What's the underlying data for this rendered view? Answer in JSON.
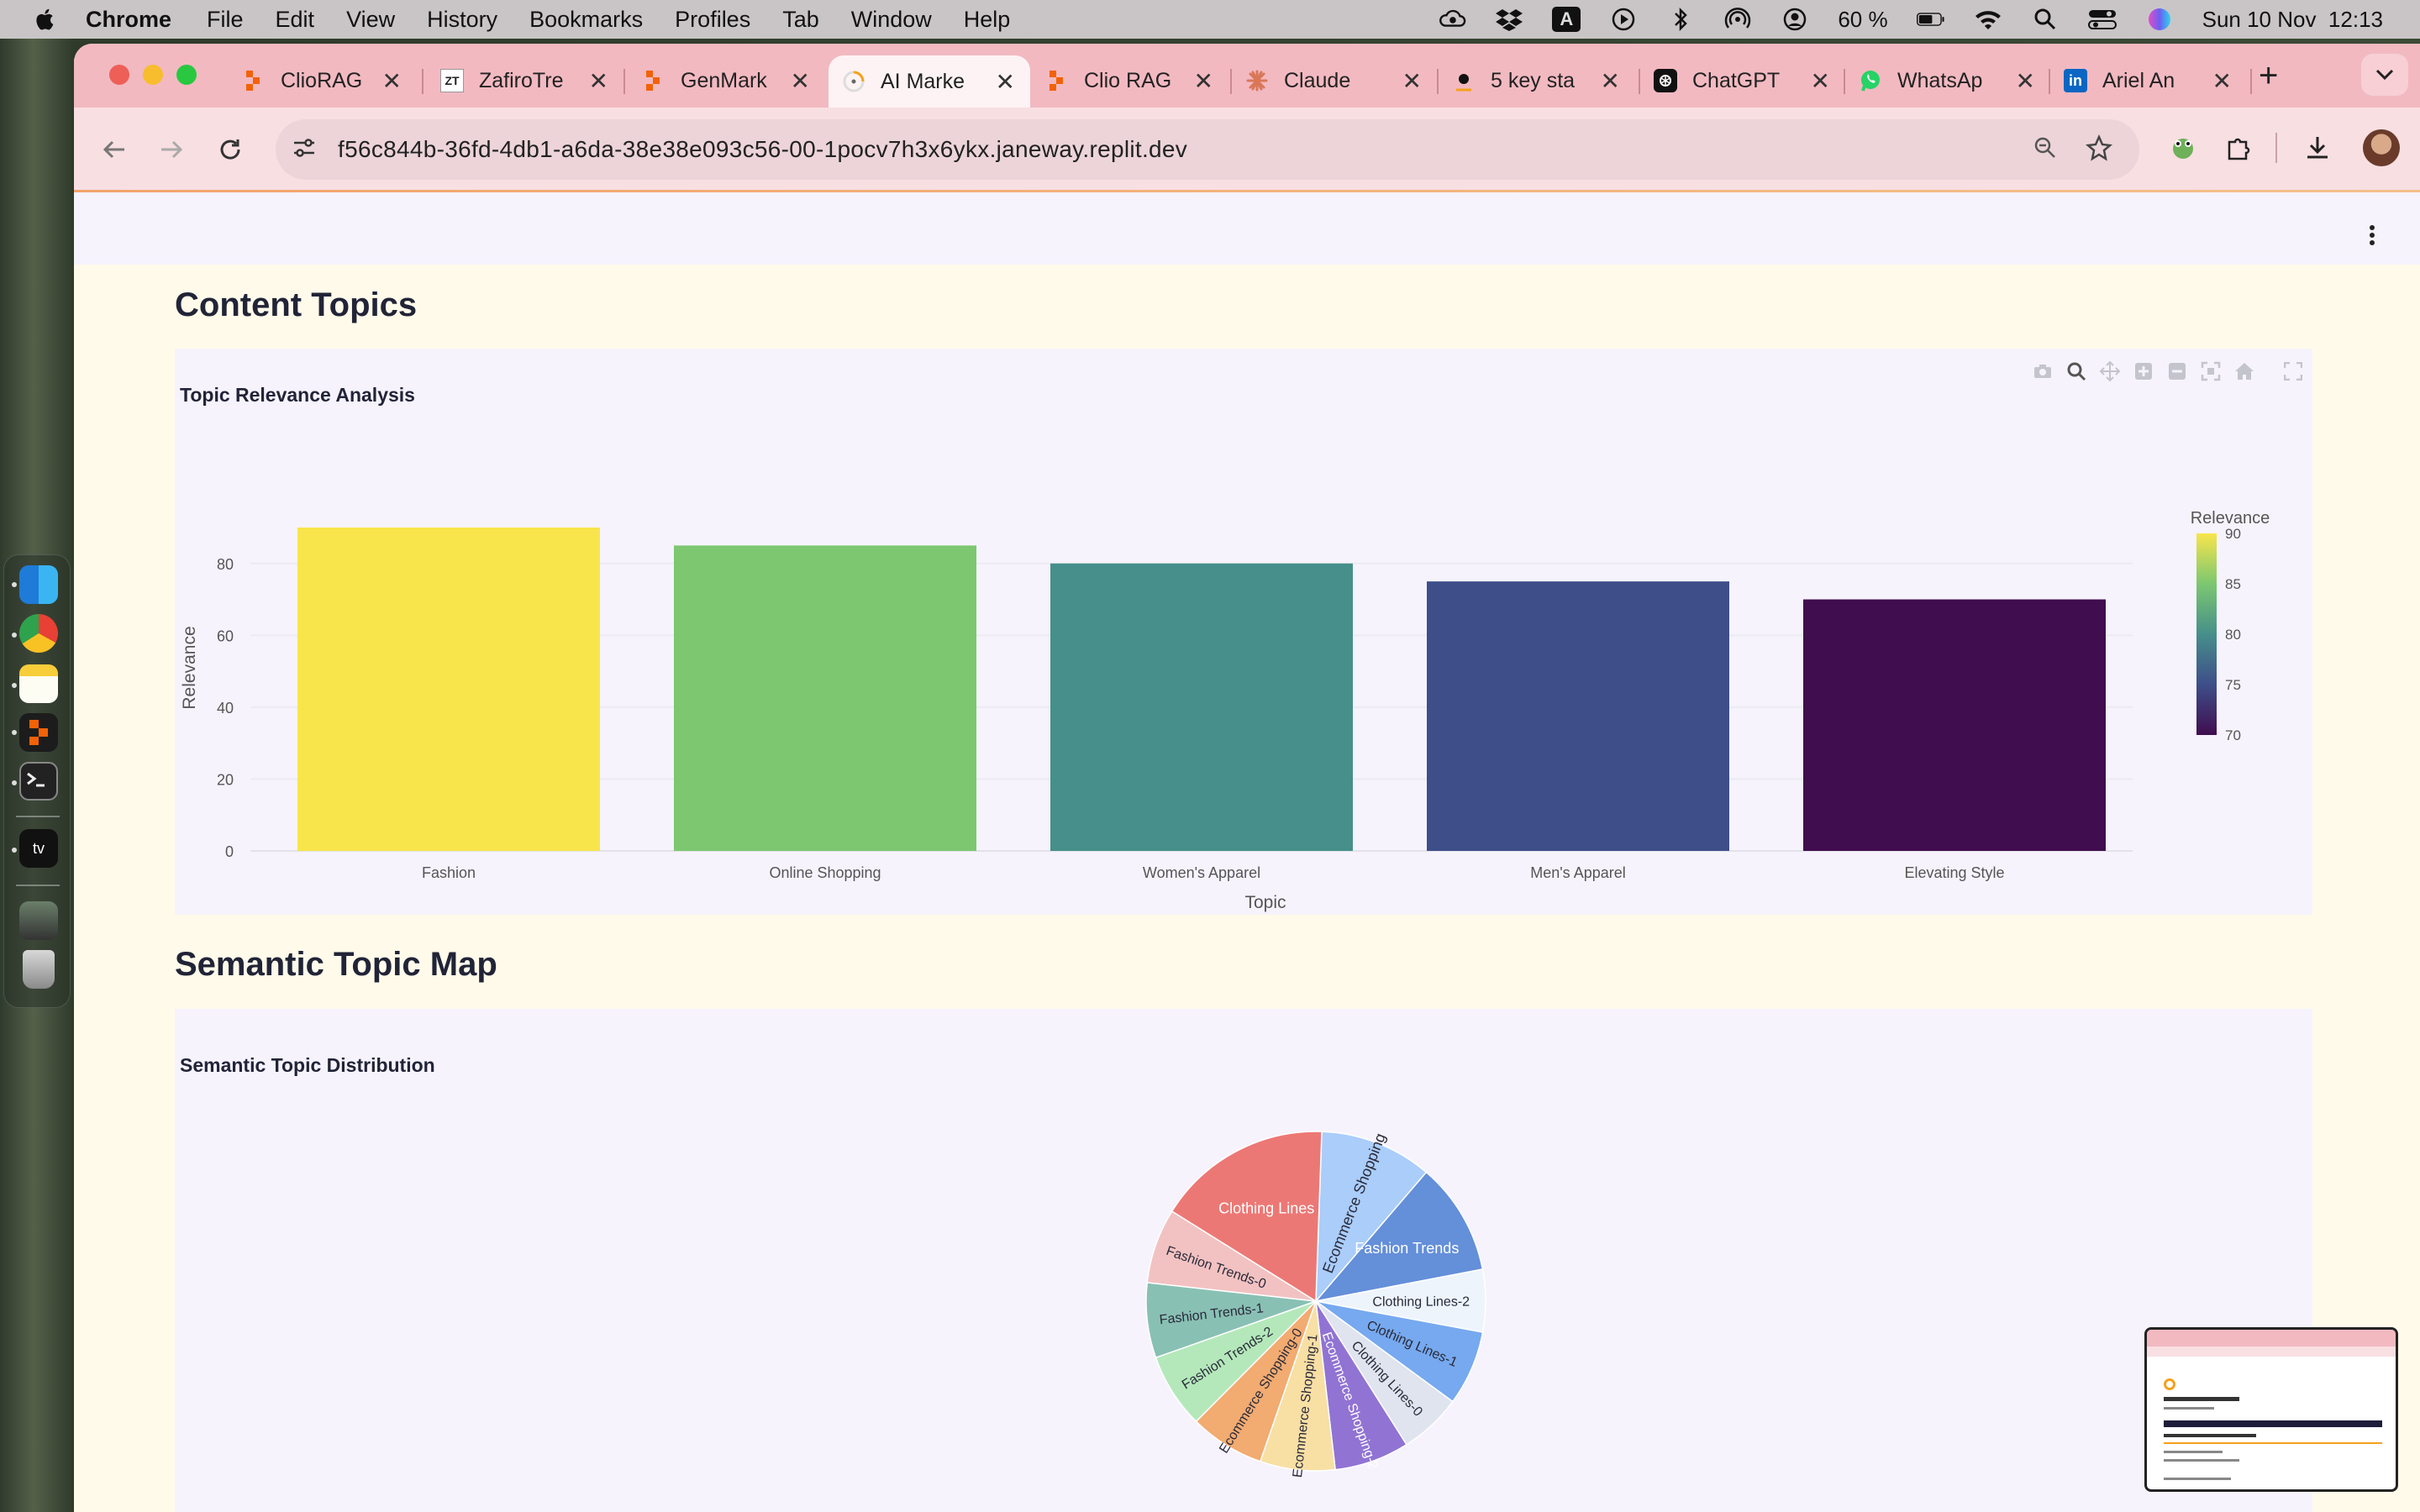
{
  "menubar": {
    "app_name": "Chrome",
    "items": [
      "File",
      "Edit",
      "View",
      "History",
      "Bookmarks",
      "Profiles",
      "Tab",
      "Window",
      "Help"
    ],
    "battery": "60 %",
    "datetime": "Sun 10 Nov  12:13",
    "keyboard_letter": "A"
  },
  "tabs": [
    {
      "title": "ClioRAG",
      "icon": "replit-icon",
      "color": "#f26207"
    },
    {
      "title": "ZafiroTre",
      "icon": "zt-icon",
      "icon_text": "ZT"
    },
    {
      "title": "GenMark",
      "icon": "replit-icon",
      "color": "#f26207"
    },
    {
      "title": "AI Marke",
      "icon": "streamlit-loader-icon",
      "active": true
    },
    {
      "title": "Clio RAG",
      "icon": "replit-icon",
      "color": "#f26207"
    },
    {
      "title": "Claude",
      "icon": "claude-icon",
      "color": "#d97757"
    },
    {
      "title": "5 key sta",
      "icon": "site-icon"
    },
    {
      "title": "ChatGPT",
      "icon": "openai-icon"
    },
    {
      "title": "WhatsAp",
      "icon": "whatsapp-icon",
      "color": "#25d366"
    },
    {
      "title": "Ariel An",
      "icon": "linkedin-icon",
      "color": "#0a66c2",
      "icon_text": "in"
    }
  ],
  "address_bar": {
    "url": "f56c844b-36fd-4db1-a6da-38e38e093c56-00-1pocv7h3x6ykx.janeway.replit.dev"
  },
  "content_topics": {
    "heading": "Content Topics",
    "plot_title": "Topic Relevance Analysis"
  },
  "semantic_map": {
    "heading": "Semantic Topic Map",
    "plot_title": "Semantic Topic Distribution"
  },
  "chart_data": [
    {
      "type": "bar",
      "title": "Topic Relevance Analysis",
      "categories": [
        "Fashion",
        "Online Shopping",
        "Women's Apparel",
        "Men's Apparel",
        "Elevating Style"
      ],
      "values": [
        90,
        85,
        80,
        75,
        70
      ],
      "colors": [
        "#f8e54b",
        "#7cc770",
        "#468f8a",
        "#3e4e89",
        "#400d4f"
      ],
      "xlabel": "Topic",
      "ylabel": "Relevance",
      "ylim": [
        0,
        90
      ],
      "yticks": [
        0,
        20,
        40,
        60,
        80
      ],
      "grid": true,
      "colorbar": {
        "title": "Relevance",
        "ticks": [
          90,
          85,
          80,
          75,
          70
        ],
        "placement": "right"
      }
    },
    {
      "type": "pie",
      "title": "Semantic Topic Distribution",
      "slices": [
        {
          "label": "Ecommerce Shopping",
          "value": 9,
          "color": "#aacdfa"
        },
        {
          "label": "Fashion Trends",
          "value": 9,
          "color": "#648fd9"
        },
        {
          "label": "Clothing Lines-2",
          "value": 5,
          "color": "#edf4fc"
        },
        {
          "label": "Clothing Lines-1",
          "value": 6,
          "color": "#76a9ef"
        },
        {
          "label": "Clothing Lines-0",
          "value": 5,
          "color": "#dfe4ef"
        },
        {
          "label": "Ecommerce Shopping-2",
          "value": 6,
          "color": "#9173d3"
        },
        {
          "label": "Ecommerce Shopping-1",
          "value": 6,
          "color": "#f8dfa4"
        },
        {
          "label": "Ecommerce Shopping-0",
          "value": 6,
          "color": "#f2ab70"
        },
        {
          "label": "Fashion Trends-2",
          "value": 6,
          "color": "#b4e8ba"
        },
        {
          "label": "Fashion Trends-1",
          "value": 6,
          "color": "#89c0b4"
        },
        {
          "label": "Fashion Trends-0",
          "value": 6,
          "color": "#f2c2c2"
        },
        {
          "label": "Clothing Lines",
          "value": 14,
          "color": "#ec7875"
        }
      ],
      "label_colors": {
        "Ecommerce Shopping": "#2a2a3a",
        "Fashion Trends": "#ffffff",
        "Clothing Lines-2": "#2a2a3a",
        "Clothing Lines-1": "#2a2a3a",
        "Clothing Lines-0": "#2a2a3a",
        "Ecommerce Shopping-2": "#ffffff",
        "Ecommerce Shopping-1": "#2a2a3a",
        "Ecommerce Shopping-0": "#2a2a3a",
        "Fashion Trends-2": "#2a2a3a",
        "Fashion Trends-1": "#2a2a3a",
        "Fashion Trends-0": "#2a2a3a",
        "Clothing Lines": "#ffffff"
      }
    }
  ]
}
